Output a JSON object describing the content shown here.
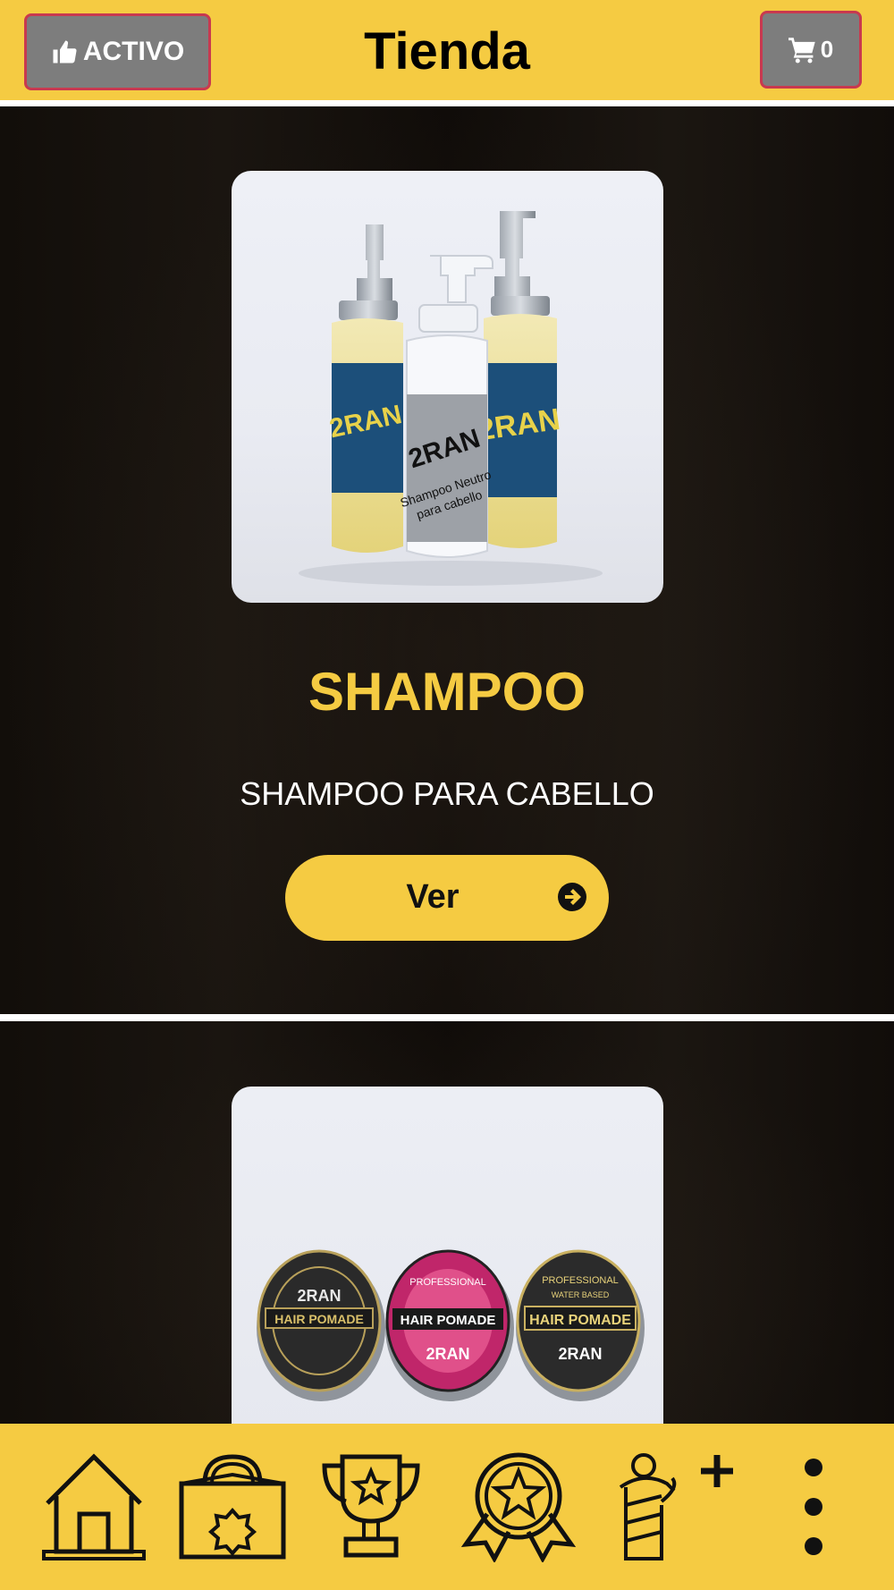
{
  "header": {
    "status_label": "ACTIVO",
    "title": "Tienda",
    "cart_count": "0"
  },
  "products": [
    {
      "name": "SHAMPOO",
      "description": "SHAMPOO PARA CABELLO",
      "button_label": "Ver",
      "image_text": {
        "brand": "2RAN",
        "label_line1": "Shampoo Neutro",
        "label_line2": "para cabello"
      }
    },
    {
      "image_text": {
        "brand": "2RAN",
        "label": "HAIR POMADE",
        "professional": "PROFESSIONAL",
        "water_based": "WATER BASED"
      }
    }
  ],
  "bottom_nav": {
    "items": [
      "home-icon",
      "shop-bag-icon",
      "trophy-icon",
      "award-badge-icon",
      "barber-add-icon",
      "more-vertical-icon"
    ]
  },
  "colors": {
    "accent": "#f5cb42",
    "button_gray": "#7d7d7d",
    "button_border": "#c8394f",
    "background": "#0a0806"
  }
}
